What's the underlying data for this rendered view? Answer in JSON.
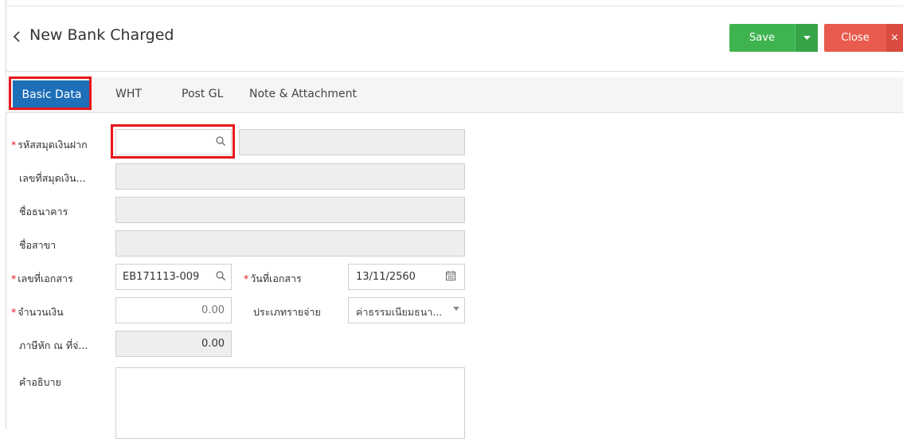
{
  "header": {
    "title": "New Bank Charged",
    "save_label": "Save",
    "close_label": "Close",
    "close_x": "×"
  },
  "tabs": [
    {
      "label": "Basic Data",
      "active": true
    },
    {
      "label": "WHT",
      "active": false
    },
    {
      "label": "Post GL",
      "active": false
    },
    {
      "label": "Note & Attachment",
      "active": false
    }
  ],
  "form": {
    "bank_book_code": {
      "label": "รหัสสมุดเงินฝาก",
      "required": true,
      "value": "",
      "desc": ""
    },
    "bank_book_no": {
      "label": "เลขที่สมุดเงิน...",
      "required": false,
      "value": ""
    },
    "bank_name": {
      "label": "ชื่อธนาคาร",
      "required": false,
      "value": ""
    },
    "branch_name": {
      "label": "ชื่อสาขา",
      "required": false,
      "value": ""
    },
    "doc_no": {
      "label": "เลขที่เอกสาร",
      "required": true,
      "value": "EB171113-009"
    },
    "doc_date": {
      "label": "วันที่เอกสาร",
      "required": true,
      "value": "13/11/2560"
    },
    "amount": {
      "label": "จำนวนเงิน",
      "required": true,
      "value": "0.00"
    },
    "expense_type": {
      "label": "ประเภทรายจ่าย",
      "required": false,
      "value": "ค่าธรรมเนียมธนา..."
    },
    "wht": {
      "label": "ภาษีหัก ณ ที่จ่...",
      "required": false,
      "value": "0.00"
    },
    "description": {
      "label": "คำอธิบาย",
      "required": false,
      "value": ""
    }
  },
  "colors": {
    "save": "#3fb350",
    "close": "#e85b4e",
    "tab_active": "#1e6fb8",
    "highlight": "#e8151b"
  }
}
